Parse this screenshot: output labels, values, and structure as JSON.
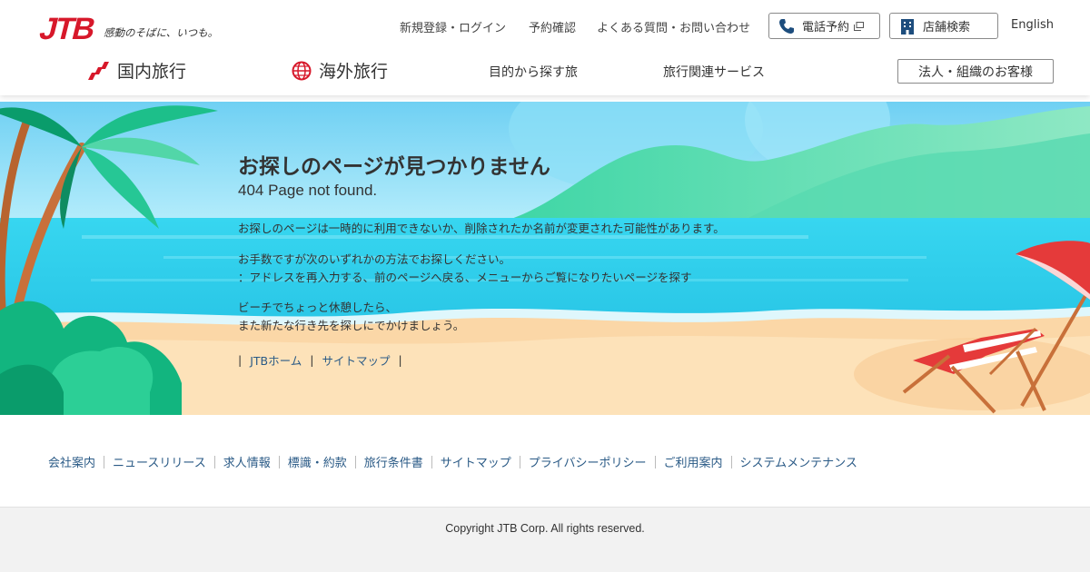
{
  "header": {
    "logo_text": "JTB",
    "tagline": "感動のそばに、いつも。",
    "util_links": {
      "login": "新規登録・ログイン",
      "reservation_check": "予約確認",
      "faq": "よくある質問・お問い合わせ"
    },
    "phone_booking": "電話予約",
    "store_search": "店舗検索",
    "english": "English"
  },
  "nav": {
    "domestic": "国内旅行",
    "overseas": "海外旅行",
    "by_purpose": "目的から探す旅",
    "services": "旅行関連サービス",
    "corporate": "法人・組織のお客様"
  },
  "hero": {
    "title": "お探しのページが見つかりません",
    "subtitle": "404 Page not found.",
    "para1": "お探しのページは一時的に利用できないか、削除されたか名前が変更された可能性があります。",
    "para2_line1": "お手数ですが次のいずれかの方法でお探しください。",
    "para2_line2": "：アドレスを再入力する、前のページへ戻る、メニューからご覧になりたいページを探す",
    "para3_line1": "ビーチでちょっと休憩したら、",
    "para3_line2": "また新たな行き先を探しにでかけましょう。",
    "links": {
      "home": "JTBホーム",
      "sitemap": "サイトマップ"
    }
  },
  "footer": {
    "links": [
      "会社案内",
      "ニュースリリース",
      "求人情報",
      "標識・約款",
      "旅行条件書",
      "サイトマップ",
      "プライバシーポリシー",
      "ご利用案内",
      "システムメンテナンス"
    ],
    "copyright": "Copyright JTB Corp. All rights reserved."
  },
  "colors": {
    "brand_red": "#d7182a",
    "link_blue": "#2a5a86",
    "sky": "#7fd8f5",
    "sea": "#2cc8e8",
    "sand": "#fbdcad"
  }
}
